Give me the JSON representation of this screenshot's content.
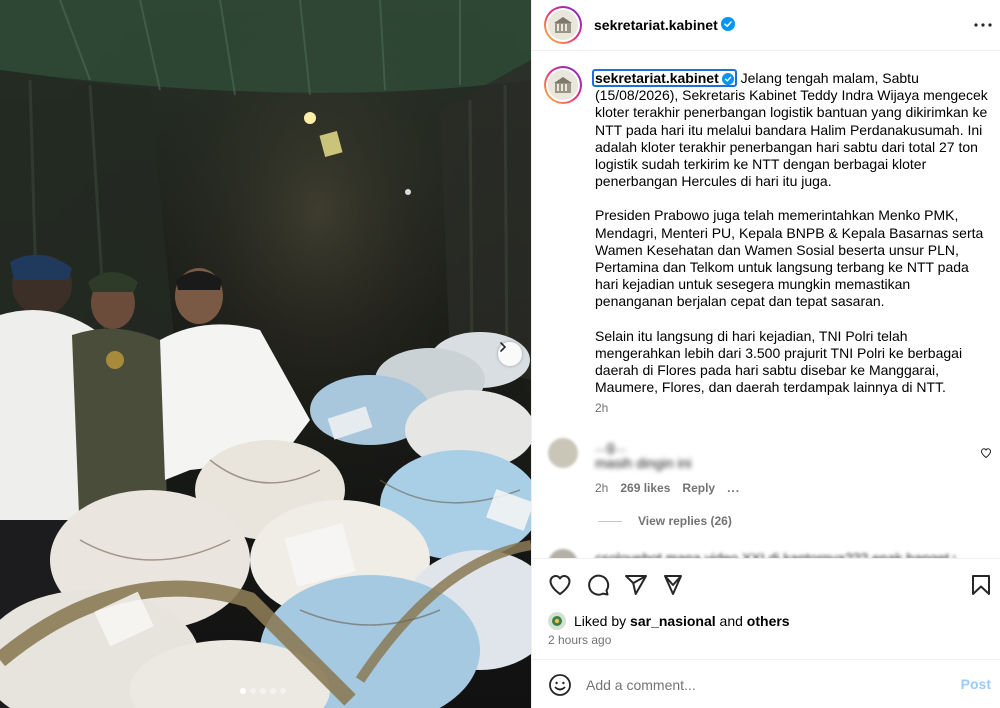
{
  "post": {
    "username": "sekretariat.kabinet",
    "more_label": "More options"
  },
  "caption": {
    "username": "sekretariat.kabinet",
    "para1_rest": "Jelang tengah malam, Sabtu (15/08/2026), Sekretaris Kabinet Teddy Indra Wijaya mengecek kloter terakhir penerbangan logistik bantuan yang dikirimkan ke NTT pada hari itu melalui bandara Halim Perdanakusumah. Ini adalah kloter terakhir penerbangan hari sabtu dari total 27 ton logistik sudah terkirim ke NTT dengan berbagai kloter penerbangan Hercules di hari itu juga.",
    "para2": "Presiden Prabowo juga telah memerintahkan Menko PMK, Mendagri, Menteri PU, Kepala BNPB & Kepala Basarnas serta Wamen Kesehatan dan Wamen Sosial beserta unsur PLN, Pertamina dan Telkom untuk langsung terbang ke NTT pada hari kejadian untuk sesegera mungkin memastikan penanganan berjalan cepat dan tepat sasaran.",
    "para3": "Selain itu langsung di hari kejadian, TNI Polri telah mengerahkan lebih dari 3.500 prajurit TNI Polri ke berbagai daerah di Flores pada hari sabtu disebar ke Manggarai, Maumere, Flores, dan daerah terdampak lainnya di NTT.",
    "time": "2h"
  },
  "comments": [
    {
      "text": "...g...",
      "text2": "masih dingin ini",
      "time": "2h",
      "likes": "269 likes",
      "reply_label": "Reply",
      "more_label": "...",
      "view_replies": "View replies (26)"
    },
    {
      "text": "csolovebot mana video XXI di kantornya??? enak banget ya"
    }
  ],
  "liked_by": {
    "prefix": "Liked by",
    "user": "sar_nasional",
    "and": "and",
    "others": "others"
  },
  "post_time": "2 hours ago",
  "add_comment": {
    "placeholder": "Add a comment...",
    "post_label": "Post"
  },
  "carousel": {
    "dots": 5,
    "active_index": 0
  },
  "colors": {
    "verified_blue": "#0095f6",
    "post_button_disabled": "#9ccbf5",
    "secondary_text": "#737373"
  },
  "icons": [
    "verified-icon",
    "more-icon",
    "heart-icon",
    "comment-icon",
    "share-icon",
    "bookmark-icon",
    "emoji-icon",
    "chevron-right-icon"
  ]
}
